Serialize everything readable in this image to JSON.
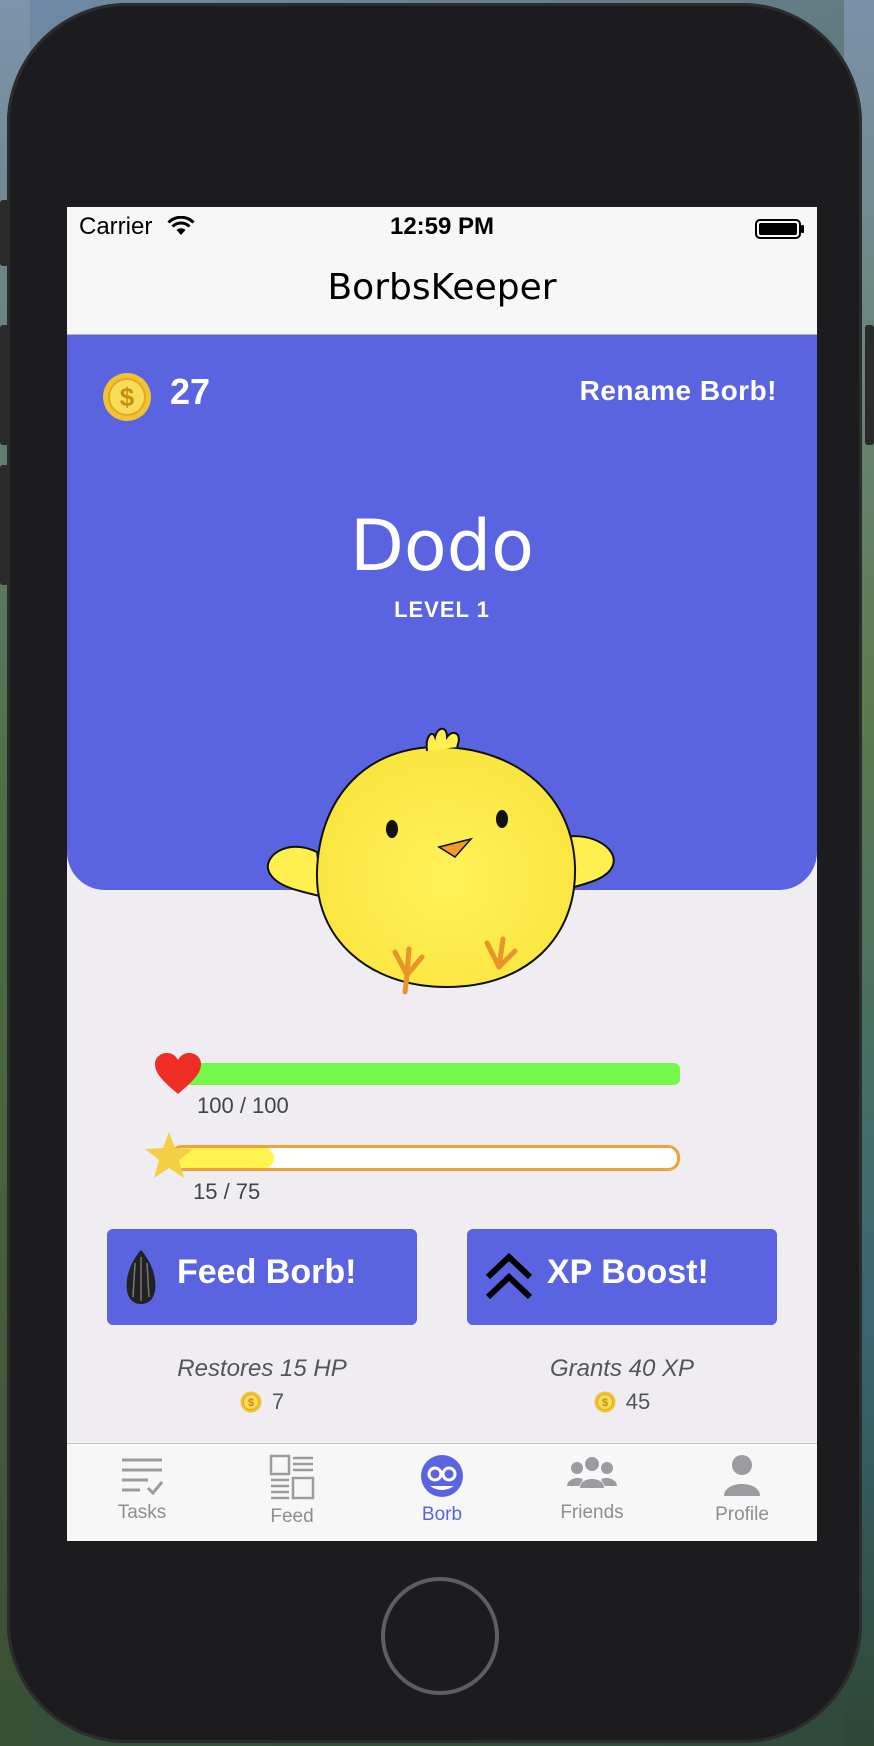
{
  "status_bar": {
    "carrier": "Carrier",
    "time": "12:59 PM"
  },
  "nav": {
    "title": "BorbsKeeper"
  },
  "hero": {
    "coins": "27",
    "rename_label": "Rename Borb!",
    "borb_name": "Dodo",
    "level_label": "LEVEL 1"
  },
  "stats": {
    "hp_text": "100 / 100",
    "hp_fraction": 1.0,
    "xp_text": "15 / 75",
    "xp_fraction": 0.2
  },
  "actions": {
    "feed": {
      "label": "Feed Borb!",
      "description": "Restores 15 HP",
      "cost": "7"
    },
    "boost": {
      "label": "XP Boost!",
      "description": "Grants 40 XP",
      "cost": "45"
    }
  },
  "tabs": [
    {
      "label": "Tasks",
      "icon": "tasks-icon",
      "active": false
    },
    {
      "label": "Feed",
      "icon": "feed-icon",
      "active": false
    },
    {
      "label": "Borb",
      "icon": "borb-icon",
      "active": true
    },
    {
      "label": "Friends",
      "icon": "friends-icon",
      "active": false
    },
    {
      "label": "Profile",
      "icon": "profile-icon",
      "active": false
    }
  ],
  "colors": {
    "accent": "#5a63e0",
    "hp_green": "#74f84b",
    "xp_yellow": "#fff34d",
    "xp_border": "#f0a23a",
    "coin_gold": "#f3cf3b"
  }
}
